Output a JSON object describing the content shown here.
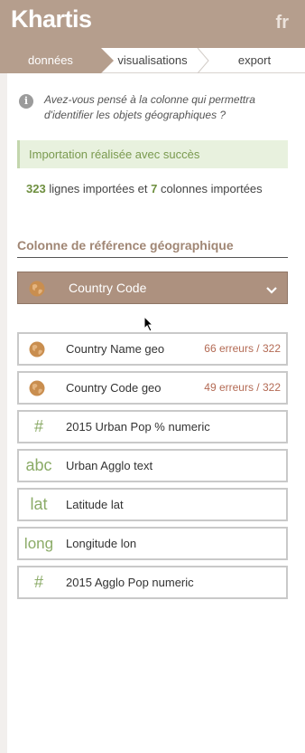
{
  "header": {
    "logo": "Khartis",
    "lang": "fr"
  },
  "tabs": [
    {
      "label": "données",
      "active": true
    },
    {
      "label": "visualisations",
      "active": false
    },
    {
      "label": "export",
      "active": false
    }
  ],
  "tip": {
    "icon": "info-icon",
    "text": "Avez-vous pensé à la colonne qui permettra d'identifier les objets géographiques ?"
  },
  "success": {
    "text": "Importation réalisée avec succès"
  },
  "counts": {
    "lines": "323",
    "lines_label": "lignes importées et",
    "columns": "7",
    "columns_label": "colonnes importées"
  },
  "geo_ref": {
    "title": "Colonne de référence géographique",
    "selected": "Country Code",
    "selected_icon": "globe-icon"
  },
  "columns": [
    {
      "icon": "globe-icon",
      "name": "Country Name geo",
      "errors": "66 erreurs / 322"
    },
    {
      "icon": "globe-icon",
      "name": "Country Code geo",
      "errors": "49 erreurs / 322"
    },
    {
      "icon": "#",
      "name": "2015 Urban Pop % numeric",
      "errors": ""
    },
    {
      "icon": "abc",
      "name": "Urban Agglo text",
      "errors": ""
    },
    {
      "icon": "lat",
      "name": "Latitude lat",
      "errors": ""
    },
    {
      "icon": "long",
      "name": "Longitude lon",
      "errors": ""
    },
    {
      "icon": "#",
      "name": "2015 Agglo Pop numeric",
      "errors": ""
    }
  ],
  "colors": {
    "brand": "#b59e8d",
    "select_bg": "#ad917f",
    "success_bg": "#e8f1de",
    "success_text": "#7a9a4f",
    "type_icon": "#8bab67",
    "error_text": "#b36a54",
    "globe": "#c98e4f"
  }
}
